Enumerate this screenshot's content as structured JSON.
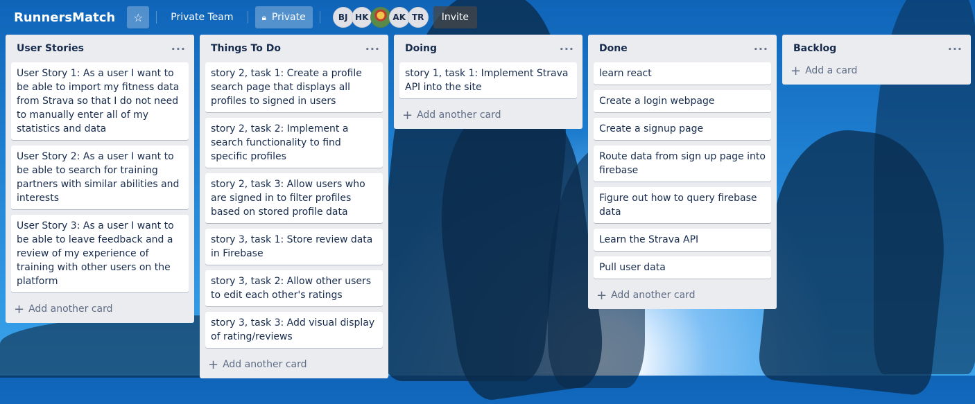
{
  "header": {
    "title": "RunnersMatch",
    "team_label": "Private Team",
    "visibility_label": "Private",
    "members": [
      "BJ",
      "HK",
      "",
      "AK",
      "TR"
    ],
    "invite_label": "Invite"
  },
  "lists": [
    {
      "title": "User Stories",
      "cards": [
        "User Story 1: As a user I want to be able to import my fitness data from Strava so that I do not need to manually enter all of my statistics and data",
        "User Story 2: As a user I want to be able to search for training partners with similar abilities and interests",
        "User Story 3: As a user I want to be able to leave feedback and a review of my experience of training with other users on the platform"
      ],
      "add_label": "Add another card"
    },
    {
      "title": "Things To Do",
      "cards": [
        "story 2, task 1: Create a profile search page that displays all profiles to signed in users",
        "story 2, task 2: Implement a search functionality to find specific profiles",
        "story 2, task 3: Allow users who are signed in to filter profiles based on stored profile data",
        "story 3, task 1: Store review data in Firebase",
        "story 3, task 2: Allow other users to edit each other's ratings",
        "story 3, task 3: Add visual display of rating/reviews"
      ],
      "add_label": "Add another card"
    },
    {
      "title": "Doing",
      "cards": [
        "story 1, task 1: Implement Strava API into the site"
      ],
      "add_label": "Add another card"
    },
    {
      "title": "Done",
      "cards": [
        "learn react",
        "Create a login webpage",
        "Create a signup page",
        "Route data from sign up page into firebase",
        "Figure out how to query firebase data",
        "Learn the Strava API",
        "Pull user data"
      ],
      "add_label": "Add another card"
    },
    {
      "title": "Backlog",
      "cards": [],
      "add_label": "Add a card"
    }
  ]
}
